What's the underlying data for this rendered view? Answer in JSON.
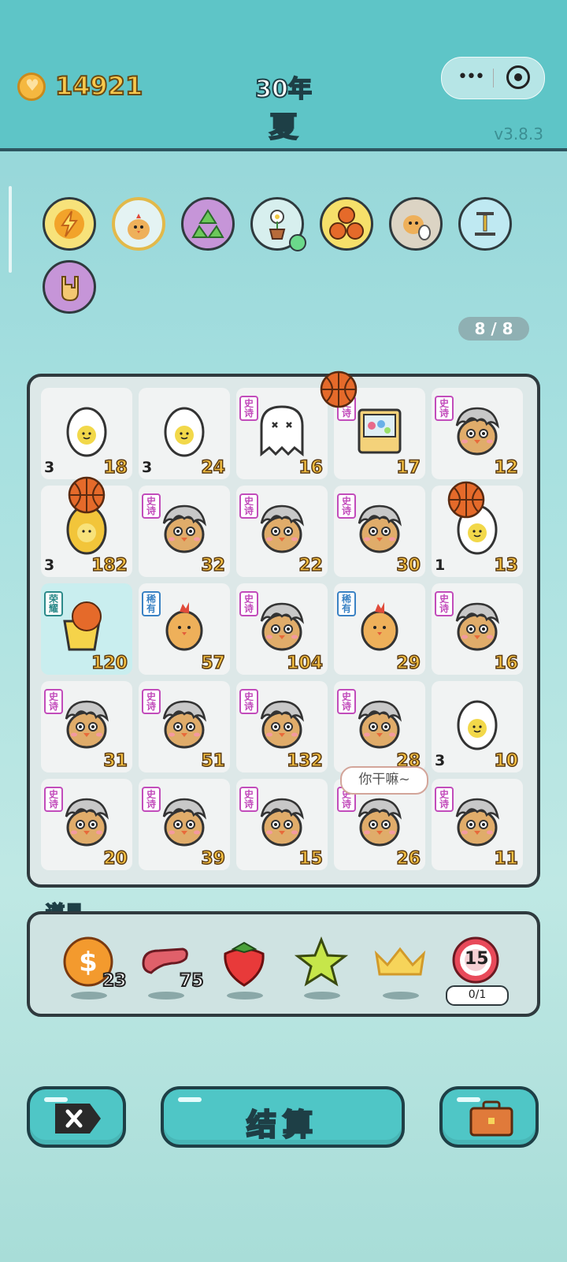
{
  "header": {
    "coins": "14921",
    "year": "30年",
    "season": "夏",
    "version": "v3.8.3"
  },
  "effects": [
    "lightning-badge",
    "chicken-badge",
    "recycle-badge",
    "flower-pot-badge",
    "basketballs-badge",
    "chick-egg-badge",
    "pump-badge",
    "rock-hand-badge"
  ],
  "counter": "8 / 8",
  "board": {
    "rows": [
      [
        {
          "item": "egg",
          "tag": "",
          "count": "3",
          "value": "18"
        },
        {
          "item": "egg",
          "tag": "",
          "count": "3",
          "value": "24"
        },
        {
          "item": "ghost",
          "tag": "史诗",
          "count": "",
          "value": "16"
        },
        {
          "item": "gacha-machine",
          "tag": "史诗",
          "count": "",
          "value": "17"
        },
        {
          "item": "gray-hair-chick",
          "tag": "史诗",
          "count": "",
          "value": "12"
        }
      ],
      [
        {
          "item": "golden-egg",
          "tag": "",
          "count": "3",
          "value": "182"
        },
        {
          "item": "gray-hair-chick",
          "tag": "史诗",
          "count": "",
          "value": "32"
        },
        {
          "item": "gray-hair-chick",
          "tag": "史诗",
          "count": "",
          "value": "22"
        },
        {
          "item": "gray-hair-chick",
          "tag": "史诗",
          "count": "",
          "value": "30"
        },
        {
          "item": "egg",
          "tag": "",
          "count": "1",
          "value": "13"
        }
      ],
      [
        {
          "item": "basketball-hoop",
          "tag": "荣耀",
          "count": "",
          "value": "120"
        },
        {
          "item": "chick",
          "tag": "稀有",
          "count": "",
          "value": "57"
        },
        {
          "item": "gray-hair-chick",
          "tag": "史诗",
          "count": "",
          "value": "104"
        },
        {
          "item": "chick",
          "tag": "稀有",
          "count": "",
          "value": "29"
        },
        {
          "item": "gray-hair-chick",
          "tag": "史诗",
          "count": "",
          "value": "16"
        }
      ],
      [
        {
          "item": "gray-hair-chick",
          "tag": "史诗",
          "count": "",
          "value": "31"
        },
        {
          "item": "gray-hair-chick",
          "tag": "史诗",
          "count": "",
          "value": "51"
        },
        {
          "item": "gray-hair-chick",
          "tag": "史诗",
          "count": "",
          "value": "132"
        },
        {
          "item": "gray-hair-chick",
          "tag": "史诗",
          "count": "",
          "value": "28"
        },
        {
          "item": "egg",
          "tag": "",
          "count": "3",
          "value": "10"
        }
      ],
      [
        {
          "item": "gray-hair-chick",
          "tag": "史诗",
          "count": "",
          "value": "20"
        },
        {
          "item": "gray-hair-chick",
          "tag": "史诗",
          "count": "",
          "value": "39"
        },
        {
          "item": "gray-hair-chick",
          "tag": "史诗",
          "count": "",
          "value": "15"
        },
        {
          "item": "gray-hair-chick",
          "tag": "史诗",
          "count": "",
          "value": "26"
        },
        {
          "item": "gray-hair-chick",
          "tag": "史诗",
          "count": "",
          "value": "11"
        }
      ]
    ]
  },
  "bubble": "你干嘛~",
  "items": {
    "label": "道具",
    "list": [
      {
        "icon": "dollar-coin-icon",
        "count": "23"
      },
      {
        "icon": "liver-icon",
        "count": "75"
      },
      {
        "icon": "strawberry-icon",
        "count": ""
      },
      {
        "icon": "star-icon",
        "count": ""
      },
      {
        "icon": "crown-icon",
        "count": ""
      },
      {
        "icon": "target-15-icon",
        "count": "",
        "badge": "15",
        "progress": "0/1"
      }
    ]
  },
  "buttons": {
    "settle": "结算"
  }
}
